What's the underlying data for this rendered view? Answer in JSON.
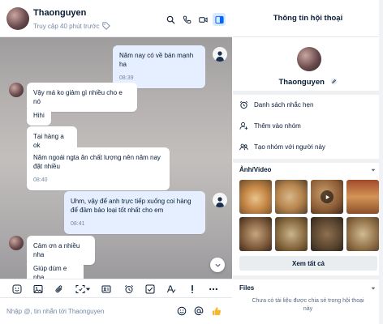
{
  "header": {
    "name": "Thaonguyen",
    "status": "Truy cập 40 phút trước"
  },
  "messages": [
    {
      "id": "m1",
      "dir": "out",
      "text": "Năm nay có về bán mạnh ha",
      "time": "08:39"
    },
    {
      "id": "m2",
      "dir": "in",
      "text": "Vậy má ko giảm gì nhiều cho e nó",
      "time": ""
    },
    {
      "id": "m3",
      "dir": "in",
      "text": "Hihi",
      "time": ""
    },
    {
      "id": "m4",
      "dir": "in",
      "text": "Tại hàng a ok",
      "time": ""
    },
    {
      "id": "m5",
      "dir": "in",
      "text": "Năm ngoái ngta ăn chất lượng nên năm nay đặt nhiều",
      "time": "08:40"
    },
    {
      "id": "m6",
      "dir": "out",
      "text": "Uhm, vậy để anh trực tiếp xuống coi hàng để đảm bảo loại tốt nhất cho em",
      "time": "08:41"
    },
    {
      "id": "m7",
      "dir": "in",
      "text": "Cảm ơn a nhiều nha",
      "time": ""
    },
    {
      "id": "m8",
      "dir": "in",
      "text": "Giúp dùm e nha",
      "time": ""
    }
  ],
  "composer": {
    "placeholder": "Nhập @, tin nhắn tới Thaonguyen"
  },
  "info": {
    "title": "Thông tin hội thoại",
    "name": "Thaonguyen",
    "actions": [
      {
        "label": "Danh sách nhắc hẹn",
        "icon": "alarm-clock-icon"
      },
      {
        "label": "Thêm vào nhóm",
        "icon": "add-user-icon"
      },
      {
        "label": "Tạo nhóm với người này",
        "icon": "group-icon"
      }
    ],
    "media_title": "Ảnh/Video",
    "media_count": 8,
    "see_all": "Xem tất cả",
    "files_title": "Files",
    "files_empty": "Chưa có tài liệu được chia sẻ trong hội thoại này"
  },
  "colors": {
    "accent": "#0068ff",
    "bubble_out": "#e5efff",
    "bubble_in": "#ffffff",
    "like": "#f5b82a"
  }
}
